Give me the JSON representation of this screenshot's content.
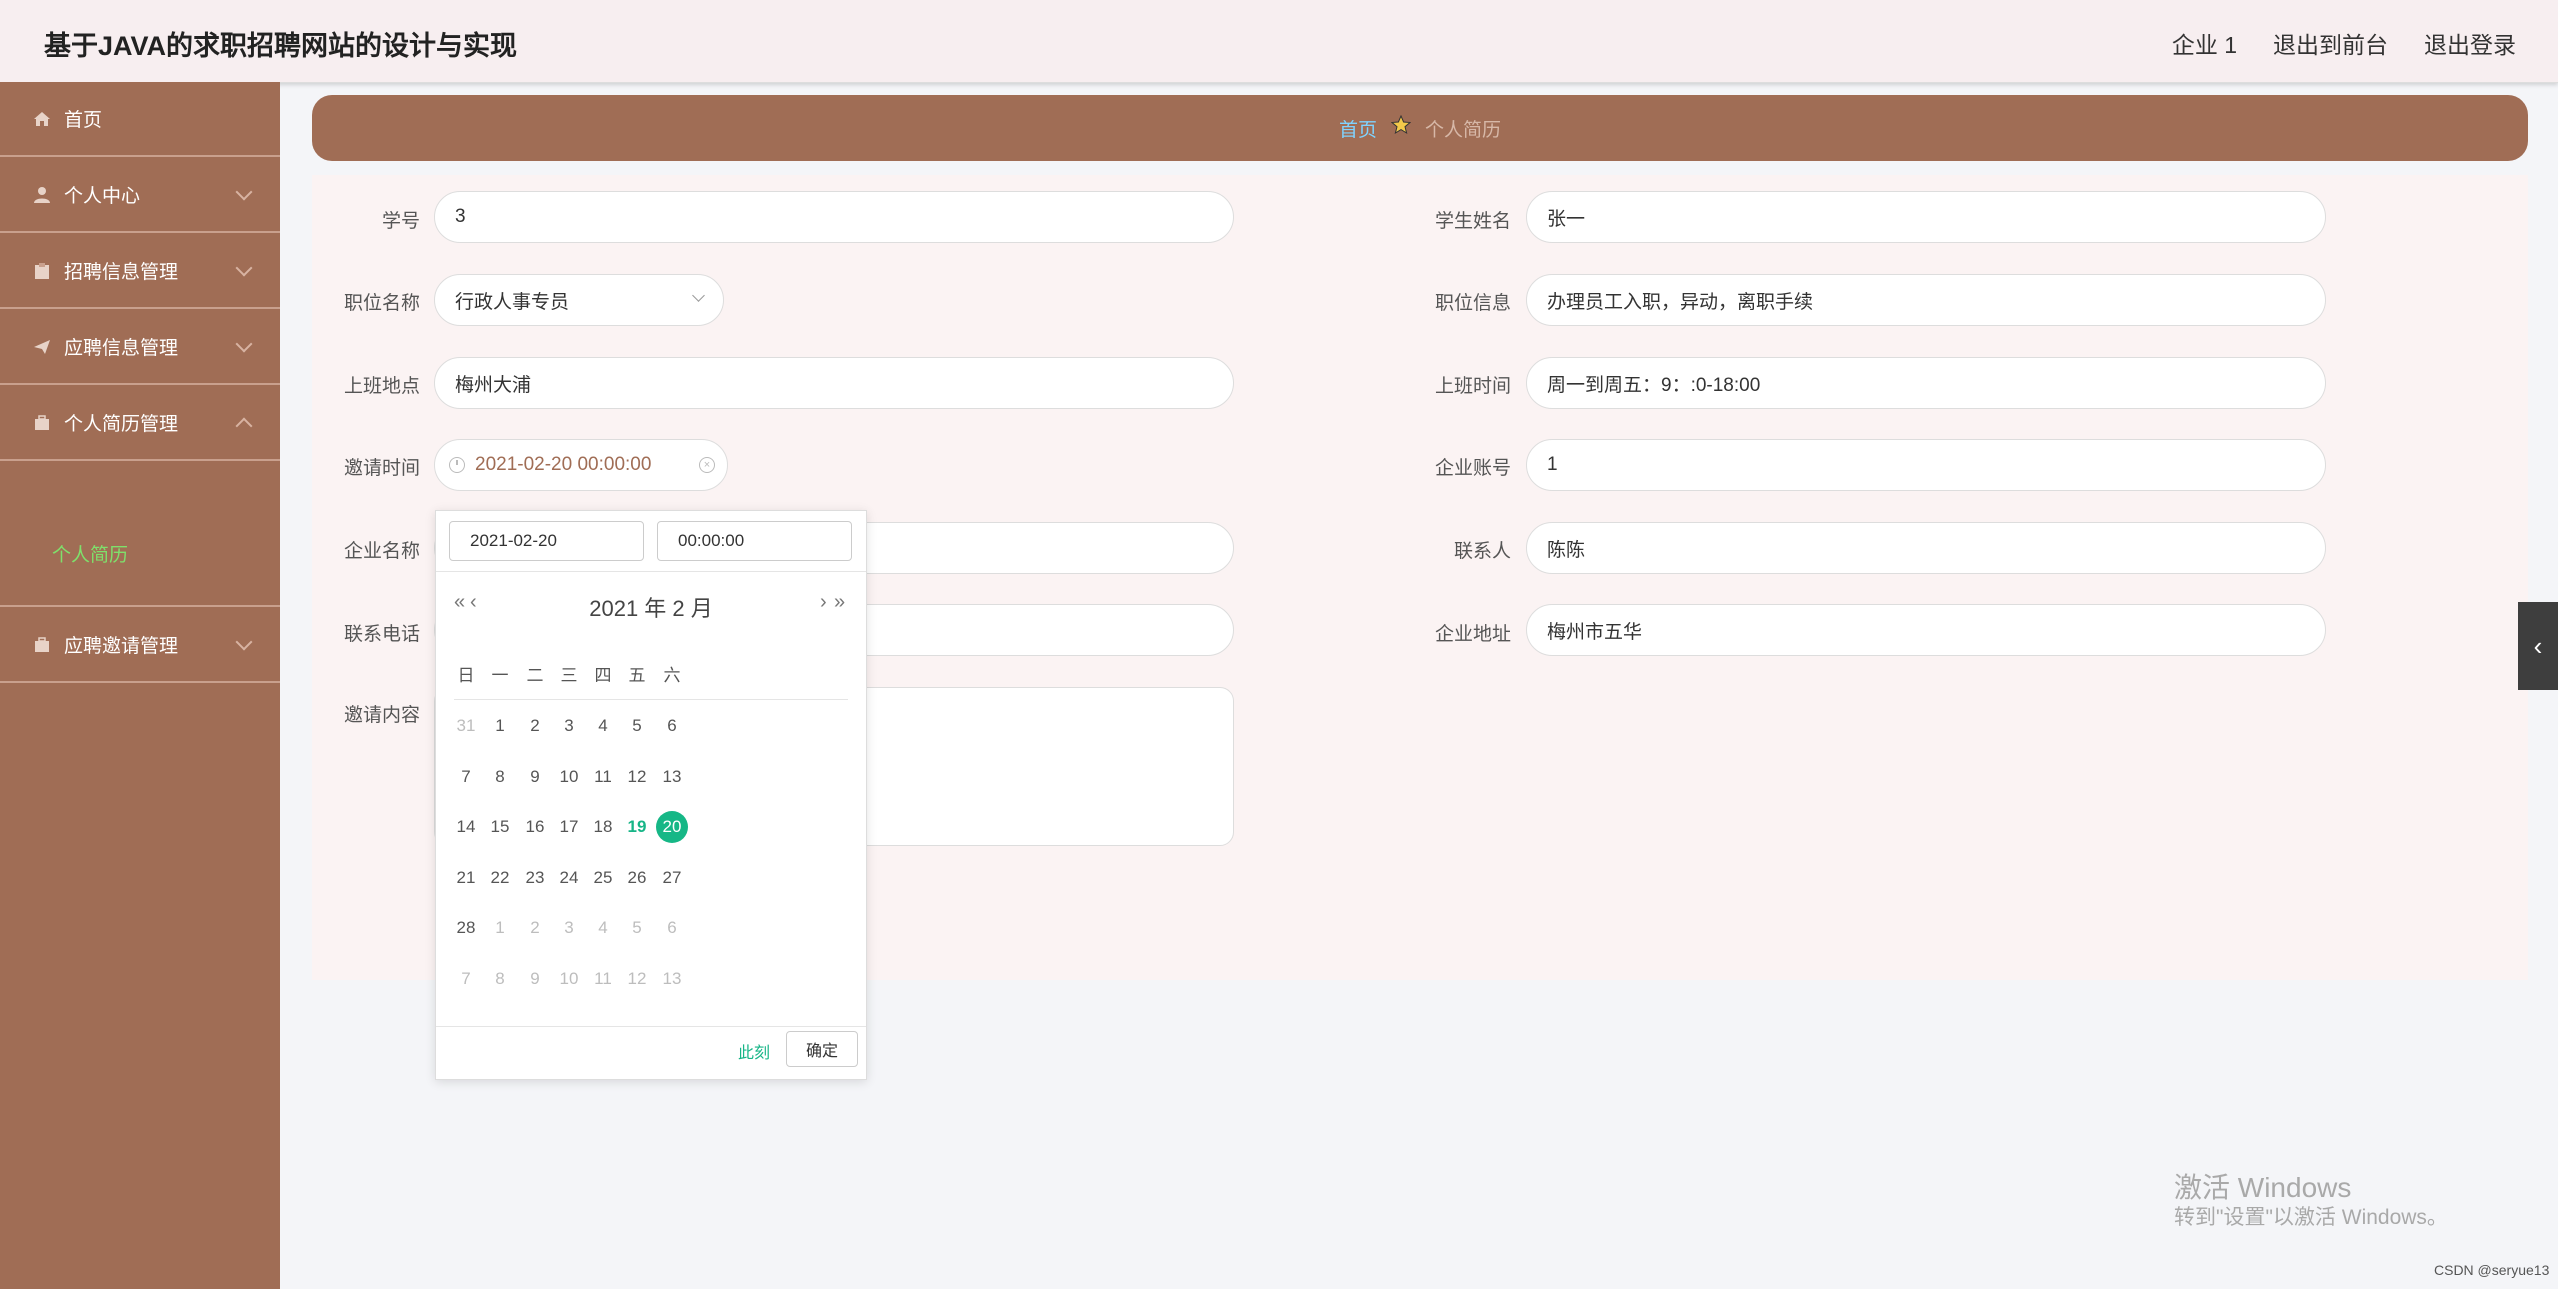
{
  "header": {
    "title": "基于JAVA的求职招聘网站的设计与实现",
    "links": [
      "企业 1",
      "退出到前台",
      "退出登录"
    ]
  },
  "sidebar": {
    "items": [
      {
        "label": "首页",
        "icon": "home-icon"
      },
      {
        "label": "个人中心",
        "icon": "user-icon"
      },
      {
        "label": "招聘信息管理",
        "icon": "clipboard-icon"
      },
      {
        "label": "应聘信息管理",
        "icon": "send-icon"
      },
      {
        "label": "个人简历管理",
        "icon": "briefcase-icon"
      },
      {
        "label": "应聘邀请管理",
        "icon": "briefcase-icon"
      }
    ],
    "sub_item": "个人简历"
  },
  "breadcrumb": {
    "home": "首页",
    "current": "个人简历"
  },
  "form": {
    "student_id": {
      "label": "学号",
      "value": "3"
    },
    "student_name": {
      "label": "学生姓名",
      "value": "张一"
    },
    "position_name": {
      "label": "职位名称",
      "value": "行政人事专员"
    },
    "position_info": {
      "label": "职位信息",
      "value": "办理员工入职，异动，离职手续"
    },
    "work_location": {
      "label": "上班地点",
      "value": "梅州大浦"
    },
    "work_time": {
      "label": "上班时间",
      "value": "周一到周五：9：:0-18:00"
    },
    "invite_time": {
      "label": "邀请时间",
      "value": "2021-02-20 00:00:00"
    },
    "company_account": {
      "label": "企业账号",
      "value": "1"
    },
    "company_name": {
      "label": "企业名称",
      "value": ""
    },
    "contact_person": {
      "label": "联系人",
      "value": "陈陈"
    },
    "contact_phone": {
      "label": "联系电话",
      "value": ""
    },
    "company_address": {
      "label": "企业地址",
      "value": "梅州市五华"
    },
    "invite_content": {
      "label": "邀请内容",
      "value": ""
    }
  },
  "date_picker": {
    "date_input": "2021-02-20",
    "time_input": "00:00:00",
    "month_title": "2021 年  2 月",
    "weekdays": [
      "日",
      "一",
      "二",
      "三",
      "四",
      "五",
      "六"
    ],
    "weeks": [
      [
        [
          "31",
          "other"
        ],
        [
          "1",
          ""
        ],
        [
          "2",
          ""
        ],
        [
          "3",
          ""
        ],
        [
          "4",
          ""
        ],
        [
          "5",
          ""
        ],
        [
          "6",
          ""
        ]
      ],
      [
        [
          "7",
          ""
        ],
        [
          "8",
          ""
        ],
        [
          "9",
          ""
        ],
        [
          "10",
          ""
        ],
        [
          "11",
          ""
        ],
        [
          "12",
          ""
        ],
        [
          "13",
          ""
        ]
      ],
      [
        [
          "14",
          ""
        ],
        [
          "15",
          ""
        ],
        [
          "16",
          ""
        ],
        [
          "17",
          ""
        ],
        [
          "18",
          ""
        ],
        [
          "19",
          "today"
        ],
        [
          "20",
          "sel"
        ]
      ],
      [
        [
          "21",
          ""
        ],
        [
          "22",
          ""
        ],
        [
          "23",
          ""
        ],
        [
          "24",
          ""
        ],
        [
          "25",
          ""
        ],
        [
          "26",
          ""
        ],
        [
          "27",
          ""
        ]
      ],
      [
        [
          "28",
          ""
        ],
        [
          "1",
          "other"
        ],
        [
          "2",
          "other"
        ],
        [
          "3",
          "other"
        ],
        [
          "4",
          "other"
        ],
        [
          "5",
          "other"
        ],
        [
          "6",
          "other"
        ]
      ],
      [
        [
          "7",
          "other"
        ],
        [
          "8",
          "other"
        ],
        [
          "9",
          "other"
        ],
        [
          "10",
          "other"
        ],
        [
          "11",
          "other"
        ],
        [
          "12",
          "other"
        ],
        [
          "13",
          "other"
        ]
      ]
    ],
    "now_label": "此刻",
    "ok_label": "确定"
  },
  "watermark": {
    "activate_title": "激活 Windows",
    "activate_sub": "转到\"设置\"以激活 Windows。",
    "csdn": "CSDN @seryue13"
  },
  "colors": {
    "sidebar": "#a06d55",
    "accent": "#16b786",
    "header": "#f7eef0"
  }
}
